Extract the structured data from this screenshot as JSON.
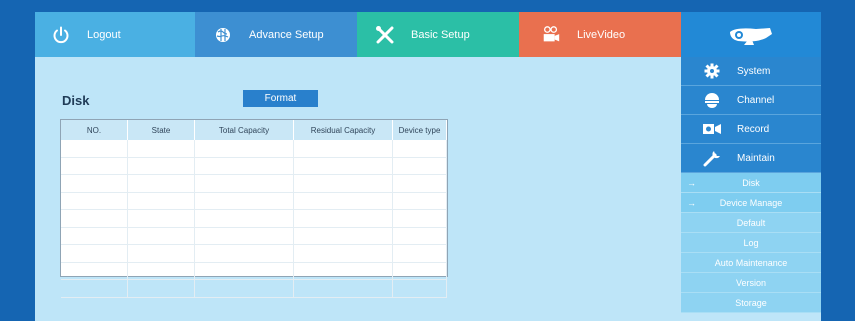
{
  "nav": {
    "logout": "Logout",
    "advance": "Advance Setup",
    "basic": "Basic Setup",
    "live": "LiveVideo"
  },
  "main": {
    "title": "Disk",
    "format": "Format",
    "columns": [
      "NO.",
      "State",
      "Total Capacity",
      "Residual Capacity",
      "Device type"
    ],
    "rows": 9
  },
  "side": {
    "buttons": [
      {
        "label": "System",
        "icon": "gear-icon"
      },
      {
        "label": "Channel",
        "icon": "dome-camera-icon"
      },
      {
        "label": "Record",
        "icon": "video-camera-icon"
      },
      {
        "label": "Maintain",
        "icon": "wrench-icon"
      }
    ],
    "items": [
      "Disk",
      "Device Manage",
      "Default",
      "Log",
      "Auto Maintenance",
      "Version",
      "Storage"
    ],
    "arrow": "→"
  },
  "colors": {
    "logout": "#4ab0e3",
    "advance": "#3d8fd2",
    "basic": "#2bbfa6",
    "live": "#e9704f",
    "background": "#1565b2"
  }
}
